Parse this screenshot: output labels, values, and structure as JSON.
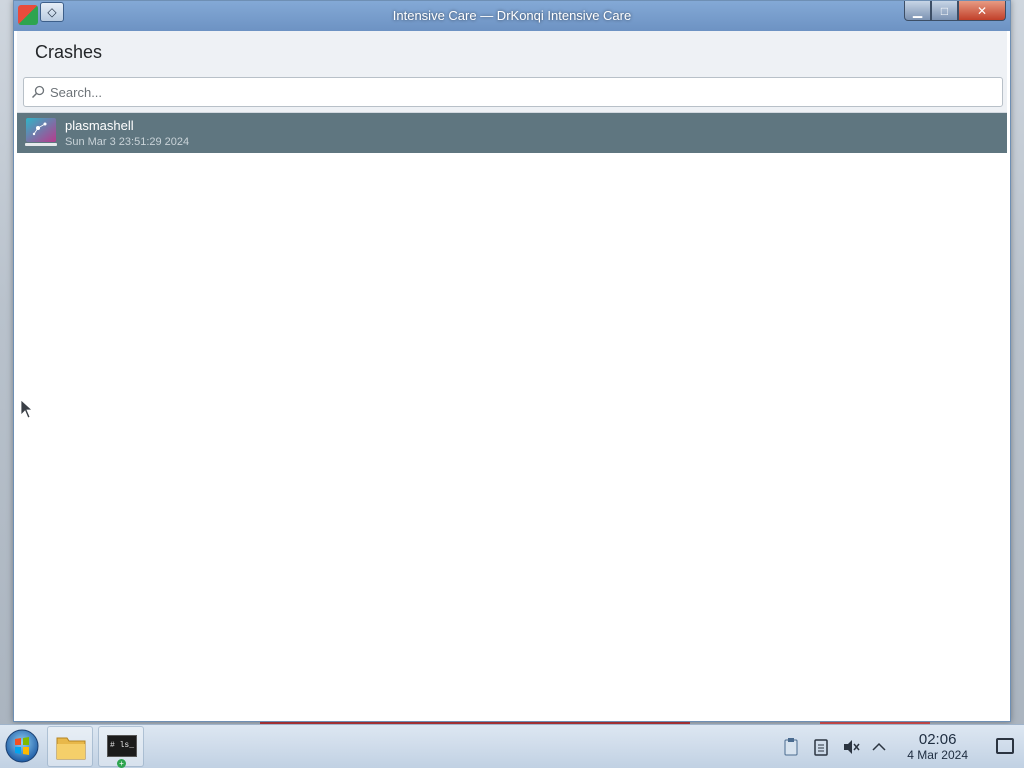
{
  "window": {
    "title": "Intensive Care — DrKonqi Intensive Care",
    "menu_icon": "diamond-icon",
    "controls": [
      "minimize",
      "maximize",
      "close"
    ]
  },
  "page": {
    "title": "Crashes"
  },
  "search": {
    "placeholder": "Search...",
    "value": ""
  },
  "crashes": [
    {
      "name": "plasmashell",
      "date": "Sun Mar 3 23:51:29 2024"
    }
  ],
  "taskbar": {
    "items": [
      "start-orb",
      "file-manager",
      "terminal"
    ],
    "terminal_label": "# ls_"
  },
  "clock": {
    "time": "02:06",
    "date": "4 Mar 2024"
  },
  "colors": {
    "selection": "#5f7680",
    "titlebar": "#4f81bd"
  }
}
